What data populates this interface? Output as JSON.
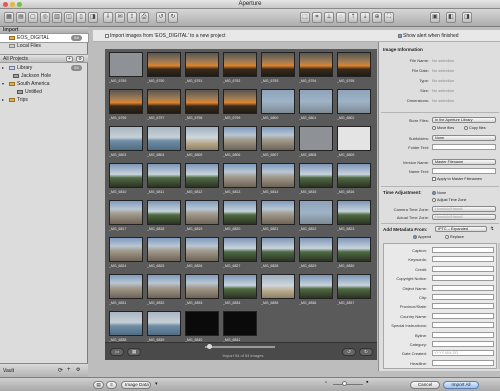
{
  "window": {
    "title": "Aperture"
  },
  "toolbar": {
    "icons": [
      "project-icon",
      "folder-icon",
      "album-icon",
      "smart-album-icon",
      "light-table-icon",
      "web-icon",
      "book-icon",
      "stack-icon",
      "import-icon",
      "email-icon",
      "export-icon",
      "print-icon",
      "rotate-left-icon",
      "rotate-right-icon",
      "selection-icon",
      "crop-icon",
      "straighten-icon",
      "spot-icon",
      "lift-icon",
      "stamp-icon",
      "loupe-icon",
      "full-screen-icon",
      "layout-icon",
      "viewer-icon",
      "browser-icon"
    ]
  },
  "sidebar": {
    "import_header": "Import",
    "import_items": [
      {
        "label": "EOS_DIGITAL",
        "badge": "54"
      },
      {
        "label": "Local Files",
        "badge": ""
      }
    ],
    "projects_popup": "All Projects",
    "projects": [
      {
        "label": "Library",
        "badge": "54"
      },
      {
        "label": "Jackson Hole",
        "badge": ""
      },
      {
        "label": "South America",
        "badge": ""
      },
      {
        "label": "Untitled",
        "badge": ""
      },
      {
        "label": "Trips",
        "badge": ""
      }
    ],
    "vault_label": "Vault"
  },
  "import_bar": {
    "checkbox_label": "Import images from 'EOS_DIGITAL' to a new project",
    "show_alert_label": "Show alert when finished"
  },
  "thumbnails": [
    {
      "caption": "_MG_6789",
      "tone": "gray"
    },
    {
      "caption": "_MG_6790",
      "tone": "sunset"
    },
    {
      "caption": "_MG_6791",
      "tone": "sunset"
    },
    {
      "caption": "_MG_6792",
      "tone": "sunset"
    },
    {
      "caption": "_MG_6793",
      "tone": "sunset"
    },
    {
      "caption": "_MG_6794",
      "tone": "sunset"
    },
    {
      "caption": "_MG_6795",
      "tone": "sunset"
    },
    {
      "caption": "_MG_6796",
      "tone": "sunset"
    },
    {
      "caption": "_MG_6797",
      "tone": "sunset"
    },
    {
      "caption": "_MG_6798",
      "tone": "sunset"
    },
    {
      "caption": "_MG_6799",
      "tone": "sunset"
    },
    {
      "caption": "_MG_6800",
      "tone": "sky"
    },
    {
      "caption": "_MG_6801",
      "tone": "sky"
    },
    {
      "caption": "_MG_6802",
      "tone": "sky"
    },
    {
      "caption": "_MG_6803",
      "tone": "sea"
    },
    {
      "caption": "_MG_6804",
      "tone": "sea"
    },
    {
      "caption": "_MG_6805",
      "tone": "beach"
    },
    {
      "caption": "_MG_6806",
      "tone": "building"
    },
    {
      "caption": "_MG_6807",
      "tone": "building"
    },
    {
      "caption": "_MG_6808",
      "tone": "gray"
    },
    {
      "caption": "_MG_6809",
      "tone": "white"
    },
    {
      "caption": "_MG_6810",
      "tone": "palm"
    },
    {
      "caption": "_MG_6811",
      "tone": "palm"
    },
    {
      "caption": "_MG_6812",
      "tone": "palm"
    },
    {
      "caption": "_MG_6813",
      "tone": "building"
    },
    {
      "caption": "_MG_6814",
      "tone": "building"
    },
    {
      "caption": "_MG_6815",
      "tone": "palm"
    },
    {
      "caption": "_MG_6816",
      "tone": "palm"
    },
    {
      "caption": "_MG_6817",
      "tone": "building"
    },
    {
      "caption": "_MG_6818",
      "tone": "palm"
    },
    {
      "caption": "_MG_6819",
      "tone": "building"
    },
    {
      "caption": "_MG_6820",
      "tone": "palm"
    },
    {
      "caption": "_MG_6821",
      "tone": "building"
    },
    {
      "caption": "_MG_6822",
      "tone": "sky"
    },
    {
      "caption": "_MG_6823",
      "tone": "palm"
    },
    {
      "caption": "_MG_6824",
      "tone": "building"
    },
    {
      "caption": "_MG_6825",
      "tone": "building"
    },
    {
      "caption": "_MG_6826",
      "tone": "building"
    },
    {
      "caption": "_MG_6827",
      "tone": "palm"
    },
    {
      "caption": "_MG_6828",
      "tone": "palm"
    },
    {
      "caption": "_MG_6829",
      "tone": "palm"
    },
    {
      "caption": "_MG_6830",
      "tone": "palm"
    },
    {
      "caption": "_MG_6831",
      "tone": "building"
    },
    {
      "caption": "_MG_6832",
      "tone": "building"
    },
    {
      "caption": "_MG_6833",
      "tone": "building"
    },
    {
      "caption": "_MG_6834",
      "tone": "palm"
    },
    {
      "caption": "_MG_6835",
      "tone": "beach"
    },
    {
      "caption": "_MG_6836",
      "tone": "palm"
    },
    {
      "caption": "_MG_6837",
      "tone": "palm"
    },
    {
      "caption": "_MG_6838",
      "tone": "sea"
    },
    {
      "caption": "_MG_6839",
      "tone": "sea"
    },
    {
      "caption": "_MG_6840",
      "tone": "black"
    },
    {
      "caption": "_MG_6841",
      "tone": "black"
    }
  ],
  "tone_colors": {
    "gray": "#8e9296",
    "sunset": "#e0842e",
    "sky": "#9fb3c6",
    "sea": "#6f8ea6",
    "beach": "#b8a98a",
    "building": "#a49c8e",
    "white": "#e4e4e4",
    "palm": "#4f6b43",
    "black": "#0a0a0a"
  },
  "grid_footer": {
    "status": "Import 54 of 54 images"
  },
  "inspector": {
    "image_info_title": "Image Information",
    "info_rows": [
      {
        "label": "File Name:",
        "value": "No selection"
      },
      {
        "label": "File Date:",
        "value": "No selection"
      },
      {
        "label": "Type:",
        "value": "No selection"
      },
      {
        "label": "Size:",
        "value": "No selection"
      },
      {
        "label": "Dimensions:",
        "value": "No selection"
      }
    ],
    "store_files_label": "Store Files:",
    "store_files_value": "In the Aperture Library",
    "move_files": "Move files",
    "copy_files": "Copy files",
    "subfolders_label": "Subfolders:",
    "subfolders_value": "None",
    "folder_text_label": "Folder Text:",
    "version_name_label": "Version Name:",
    "version_name_value": "Master Filename",
    "name_text_label": "Name Text:",
    "apply_label": "Apply to Master Filenames",
    "time_adjust_title": "Time Adjustment:",
    "time_none": "None",
    "time_adjust_zone": "Adjust Time Zone",
    "camera_tz_label": "Camera Time Zone:",
    "camera_tz_value": "Honolulu/Hawaii",
    "actual_tz_label": "Actual Time Zone:",
    "actual_tz_value": "Honolulu/Hawaii",
    "metadata_title": "Add Metadata From:",
    "metadata_value": "IPTC – Expanded",
    "append": "Append",
    "replace": "Replace",
    "meta_fields": [
      "Caption:",
      "Keywords:",
      "Credit:",
      "Copyright Notice:",
      "Object Name:",
      "City:",
      "Province/State:",
      "Country Name:",
      "Special Instructions:",
      "Byline:",
      "Category:",
      "Date Created:",
      "Headline:"
    ],
    "date_placeholder": "YYYY-MM-DD"
  },
  "bottombar": {
    "view": "Image Data",
    "cancel": "Cancel",
    "import_all": "Import All"
  }
}
